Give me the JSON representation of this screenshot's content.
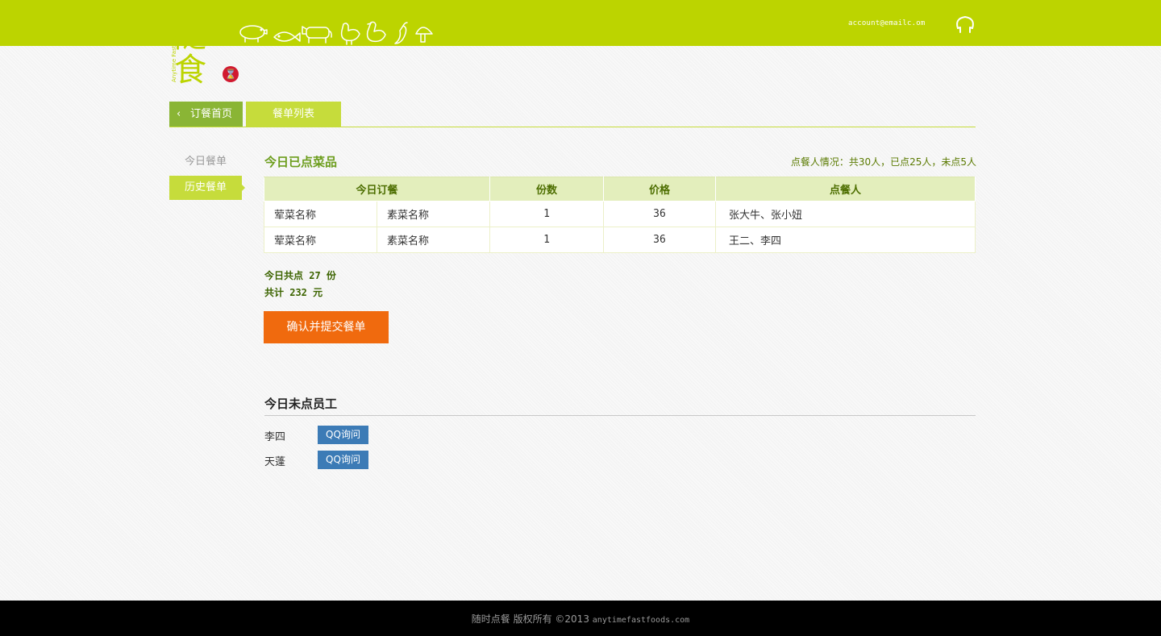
{
  "header": {
    "logo_text": "随食",
    "logo_sub": "Anytime Fast Food",
    "badge": "⌛",
    "account": "account@emailc.om",
    "icons": [
      "pig-icon",
      "fish-icon",
      "cow-icon",
      "chicken-icon",
      "duck-icon",
      "pepper-icon",
      "mushroom-icon",
      "user-icon"
    ]
  },
  "nav": {
    "home_label": "订餐首页",
    "list_label": "餐单列表"
  },
  "sidebar": {
    "items": [
      {
        "label": "今日餐单",
        "active": false
      },
      {
        "label": "历史餐单",
        "active": true
      }
    ]
  },
  "ordered": {
    "title": "今日已点菜品",
    "summary": "点餐人情况：共30人，已点25人，未点5人",
    "columns": [
      "今日订餐",
      "份数",
      "价格",
      "点餐人"
    ],
    "rows": [
      {
        "meat": "荤菜名称",
        "veg": "素菜名称",
        "qty": "1",
        "price": "36",
        "people": "张大牛、张小妞"
      },
      {
        "meat": "荤菜名称",
        "veg": "素菜名称",
        "qty": "1",
        "price": "36",
        "people": "王二、李四"
      }
    ],
    "total_count": "今日共点 27 份",
    "total_price": "共计 232 元",
    "submit_label": "确认并提交餐单"
  },
  "unordered": {
    "title": "今日未点员工",
    "staff": [
      {
        "name": "李四",
        "button": "QQ询问"
      },
      {
        "name": "天蓬",
        "button": "QQ询问"
      }
    ]
  },
  "footer": {
    "text": "随时点餐  版权所有   ©2013",
    "url": "anytimefastfoods.com"
  },
  "colors": {
    "brand_green": "#bcd400",
    "nav_dark_green": "#8ab535",
    "accent_orange": "#f06a0e",
    "qq_blue": "#3c7bb6",
    "badge_red": "#d1192f"
  }
}
